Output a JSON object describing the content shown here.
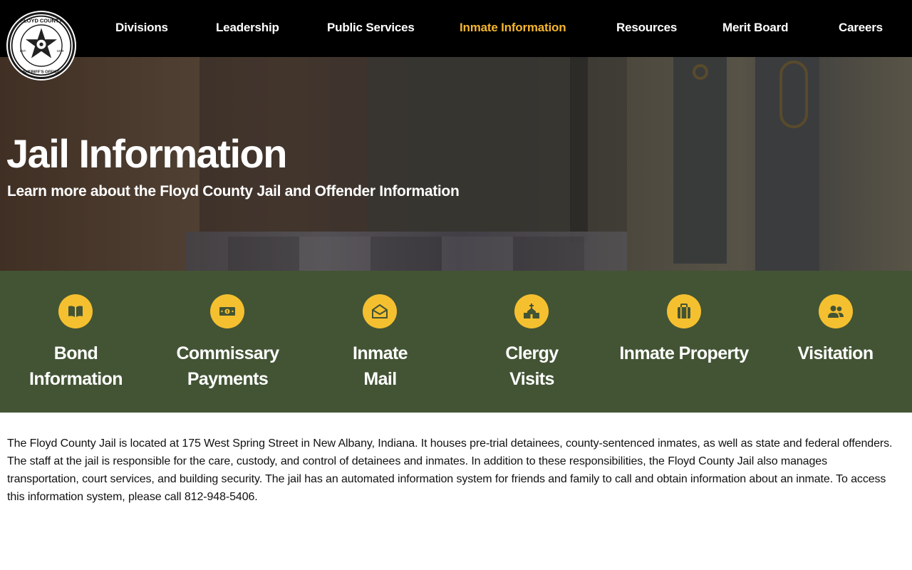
{
  "site": {
    "logo": {
      "top_text": "FLOYD COUNTY",
      "bottom_text": "SHERIFF'S OFFICE",
      "est": "EST.",
      "year": "1819"
    }
  },
  "nav": {
    "items": [
      {
        "label": "Divisions"
      },
      {
        "label": "Leadership"
      },
      {
        "label": "Public Services"
      },
      {
        "label": "Inmate Information",
        "active": true
      },
      {
        "label": "Resources"
      },
      {
        "label": "Merit Board"
      },
      {
        "label": "Careers"
      }
    ]
  },
  "hero": {
    "title": "Jail Information",
    "subtitle": "Learn more about the Floyd County Jail and Offender Information"
  },
  "quicklinks": {
    "items": [
      {
        "label": "Bond\nInformation",
        "icon": "book-icon"
      },
      {
        "label": "Commissary\nPayments",
        "icon": "money-icon"
      },
      {
        "label": "Inmate\nMail",
        "icon": "envelope-open-icon"
      },
      {
        "label": "Clergy\nVisits",
        "icon": "church-icon"
      },
      {
        "label": "Inmate Property",
        "icon": "suitcase-icon"
      },
      {
        "label": "Visitation",
        "icon": "users-icon"
      }
    ]
  },
  "content": {
    "paragraph": "The Floyd County Jail is located at 175 West Spring Street in New Albany, Indiana. It houses pre-trial detainees, county-sentenced inmates, as well as state and federal offenders. The staff at the jail is responsible for the care, custody, and control of detainees and inmates. In addition to these responsibilities, the Floyd County Jail also manages transportation, court services, and building security. The jail has an automated information system for friends and family to call and obtain information about an inmate. To access this information system, please call 812-948-5406."
  },
  "colors": {
    "header_bg": "#000000",
    "nav_active": "#f5b531",
    "quicklinks_bg": "#435434",
    "icon_circle": "#f5c02f",
    "icon_glyph": "#435434"
  }
}
